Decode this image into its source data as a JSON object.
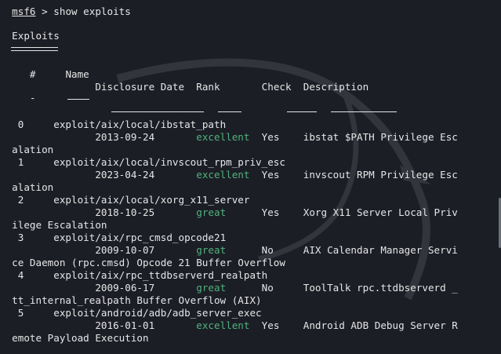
{
  "prompt": {
    "name": "msf6",
    "command": "> show exploits"
  },
  "section_title": "Exploits",
  "headers": {
    "num": "#",
    "name": "Name",
    "date": "Disclosure Date",
    "rank": "Rank",
    "check": "Check",
    "desc": "Description",
    "num_ul": "-"
  },
  "rows": [
    {
      "num": "0",
      "name": "exploit/aix/local/ibstat_path",
      "date": "2013-09-24",
      "rank": "excellent",
      "check": "Yes",
      "desc_a": "ibstat $PATH Privilege Esc",
      "desc_b": "alation"
    },
    {
      "num": "1",
      "name": "exploit/aix/local/invscout_rpm_priv_esc",
      "date": "2023-04-24",
      "rank": "excellent",
      "check": "Yes",
      "desc_a": "invscout RPM Privilege Esc",
      "desc_b": "alation"
    },
    {
      "num": "2",
      "name": "exploit/aix/local/xorg_x11_server",
      "date": "2018-10-25",
      "rank": "great",
      "check": "Yes",
      "desc_a": "Xorg X11 Server Local Priv",
      "desc_b": "ilege Escalation"
    },
    {
      "num": "3",
      "name": "exploit/aix/rpc_cmsd_opcode21",
      "date": "2009-10-07",
      "rank": "great",
      "check": "No",
      "desc_a": "AIX Calendar Manager Servi",
      "desc_b": "ce Daemon (rpc.cmsd) Opcode 21 Buffer Overflow"
    },
    {
      "num": "4",
      "name": "exploit/aix/rpc_ttdbserverd_realpath",
      "date": "2009-06-17",
      "rank": "great",
      "check": "No",
      "desc_a": "ToolTalk rpc.ttdbserverd _",
      "desc_b": "tt_internal_realpath Buffer Overflow (AIX)"
    },
    {
      "num": "5",
      "name": "exploit/android/adb/adb_server_exec",
      "date": "2016-01-01",
      "rank": "excellent",
      "check": "Yes",
      "desc_a": "Android ADB Debug Server R",
      "desc_b": "emote Payload Execution"
    }
  ]
}
